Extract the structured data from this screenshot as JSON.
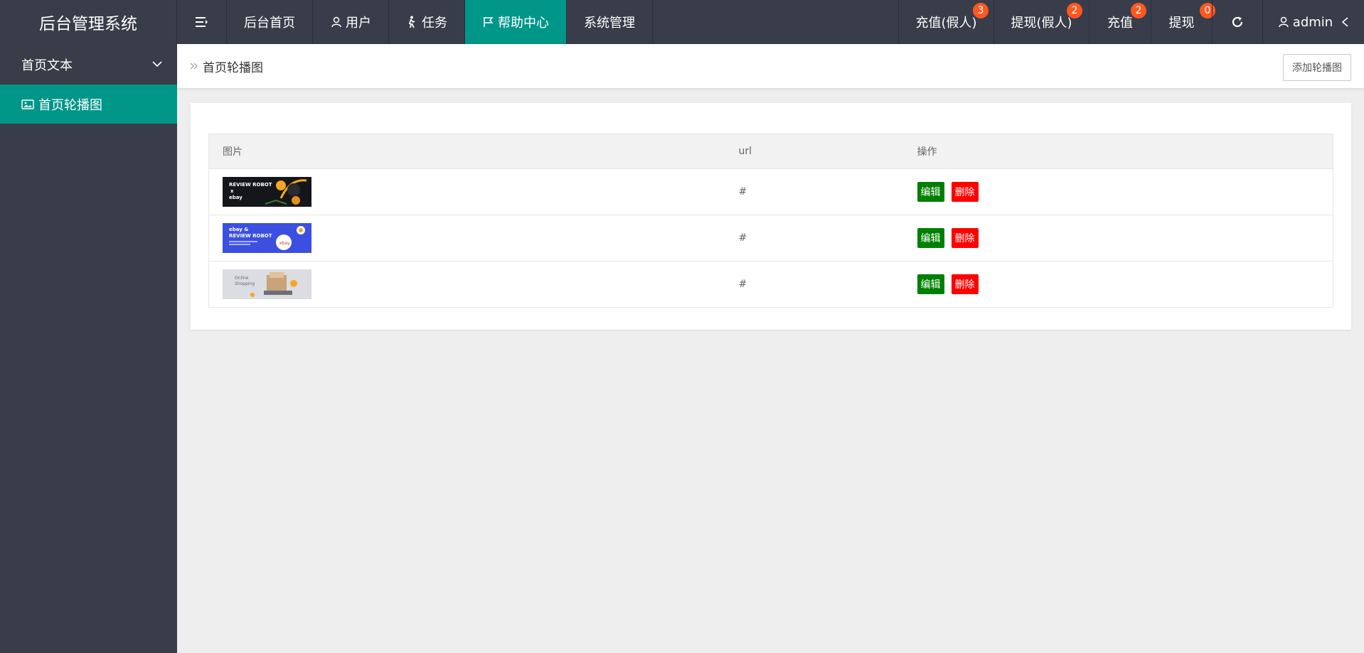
{
  "app": {
    "title": "后台管理系统"
  },
  "topnav": {
    "items": [
      {
        "label": "后台首页"
      },
      {
        "label": "用户",
        "icon": "user-icon"
      },
      {
        "label": "任务",
        "icon": "walker-icon"
      },
      {
        "label": "帮助中心",
        "icon": "flag-icon",
        "active": true
      },
      {
        "label": "系统管理"
      }
    ],
    "right": [
      {
        "label": "充值(假人)",
        "badge": "3"
      },
      {
        "label": "提现(假人)",
        "badge": "2"
      },
      {
        "label": "充值",
        "badge": "2"
      },
      {
        "label": "提现",
        "badge": "0"
      }
    ],
    "user": "admin"
  },
  "sidebar": {
    "group": "首页文本",
    "items": [
      {
        "label": "首页轮播图",
        "icon": "image-icon"
      }
    ]
  },
  "breadcrumb": {
    "current": "首页轮播图"
  },
  "toolbar": {
    "add_label": "添加轮播图"
  },
  "table": {
    "headers": [
      "图片",
      "url",
      "操作"
    ],
    "rows": [
      {
        "image": "review-robot-x-ebay-banner",
        "url": "#",
        "edit": "编辑",
        "delete": "删除"
      },
      {
        "image": "ebay-and-review-robot-banner",
        "url": "#",
        "edit": "编辑",
        "delete": "删除"
      },
      {
        "image": "online-shopping-banner",
        "url": "#",
        "edit": "编辑",
        "delete": "删除"
      }
    ]
  },
  "banners": {
    "b1": {
      "line1": "REVIEW ROBOT",
      "line2": "x",
      "line3": "ebay"
    },
    "b2": {
      "line1": "ebay  &",
      "line2": "REVIEW ROBOT",
      "logo": "ebay"
    },
    "b3": {
      "line1": "Online",
      "line2": "Shopping"
    }
  },
  "colors": {
    "header_bg": "#393d49",
    "accent": "#009688",
    "badge": "#ff5722",
    "edit": "#008000",
    "delete": "#ff0000"
  }
}
